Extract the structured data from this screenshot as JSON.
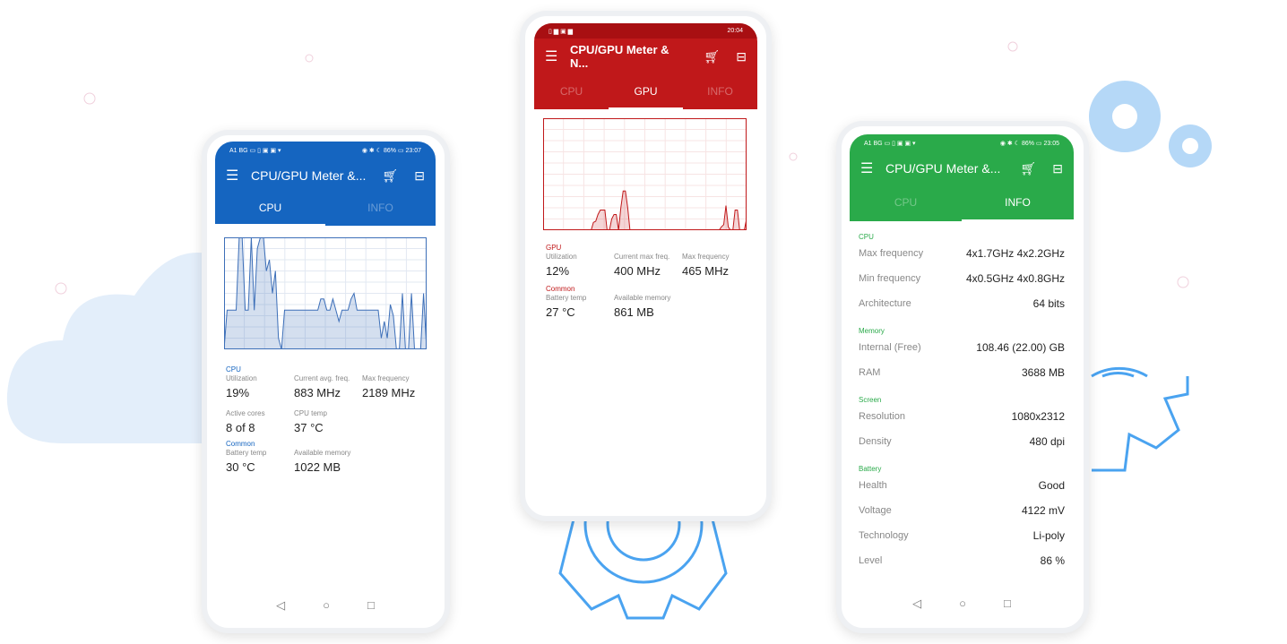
{
  "app_title": "CPU/GPU Meter & N...",
  "app_title_short": "CPU/GPU Meter &...",
  "icons": [
    "menu-icon",
    "cart-icon",
    "gift-icon",
    "back-icon",
    "home-icon",
    "recents-icon"
  ],
  "colors": {
    "blue": "#1565c0",
    "red": "#c0181a",
    "green": "#2aaa4a"
  },
  "left": {
    "status_left": "A1 BG ▭ ▯ ▣ ▣ ▾",
    "status_right": "◉ ✱ ☾ 86% ▭ 23:07",
    "tabs": [
      "CPU",
      "INFO"
    ],
    "active_tab": "CPU",
    "chart_values": [
      0,
      35,
      35,
      35,
      35,
      100,
      100,
      35,
      35,
      100,
      35,
      90,
      100,
      100,
      70,
      80,
      50,
      70,
      10,
      0,
      35,
      35,
      35,
      35,
      35,
      35,
      35,
      35,
      35,
      35,
      35,
      35,
      45,
      45,
      35,
      35,
      45,
      35,
      25,
      35,
      35,
      35,
      45,
      50,
      35,
      35,
      35,
      35,
      35,
      35,
      35,
      35,
      10,
      25,
      10,
      40,
      30,
      0,
      0,
      50,
      0,
      0,
      50,
      0,
      0,
      0,
      50,
      0
    ],
    "section_cpu": "CPU",
    "metrics": [
      {
        "label": "Utilization",
        "value": "19%"
      },
      {
        "label": "Current avg. freq.",
        "value": "883 MHz"
      },
      {
        "label": "Max frequency",
        "value": "2189 MHz"
      },
      {
        "label": "Active cores",
        "value": "8 of 8"
      },
      {
        "label": "CPU temp",
        "value": "37 °C"
      }
    ],
    "section_common": "Common",
    "common": [
      {
        "label": "Battery temp",
        "value": "30 °C"
      },
      {
        "label": "Available memory",
        "value": "1022 MB"
      }
    ]
  },
  "middle": {
    "status_right": "20:04",
    "tabs": [
      "CPU",
      "GPU",
      "INFO"
    ],
    "active_tab": "GPU",
    "chart_values": [
      0,
      0,
      0,
      0,
      0,
      0,
      0,
      0,
      0,
      0,
      0,
      0,
      0,
      0,
      0,
      0,
      0,
      0,
      0,
      0,
      0,
      0,
      7,
      8,
      14,
      18,
      18,
      18,
      0,
      0,
      10,
      14,
      14,
      0,
      20,
      35,
      35,
      20,
      0,
      0,
      0,
      0,
      0,
      0,
      0,
      0,
      0,
      0,
      0,
      0,
      0,
      0,
      0,
      0,
      0,
      0,
      0,
      0,
      0,
      0,
      0,
      0,
      0,
      0,
      0,
      0,
      0,
      0,
      0,
      0,
      0,
      0,
      0,
      0,
      0,
      0,
      0,
      0,
      3,
      5,
      22,
      3,
      0,
      0,
      18,
      18,
      0,
      0,
      0,
      10
    ],
    "section_gpu": "GPU",
    "metrics": [
      {
        "label": "Utilization",
        "value": "12%"
      },
      {
        "label": "Current max freq.",
        "value": "400 MHz"
      },
      {
        "label": "Max frequency",
        "value": "465 MHz"
      }
    ],
    "section_common": "Common",
    "common": [
      {
        "label": "Battery temp",
        "value": "27 °C"
      },
      {
        "label": "Available memory",
        "value": "861 MB"
      }
    ]
  },
  "right": {
    "status_left": "A1 BG ▭ ▯ ▣ ▣ ▾",
    "status_right": "◉ ✱ ☾ 86% ▭ 23:05",
    "tabs": [
      "CPU",
      "INFO"
    ],
    "active_tab": "INFO",
    "sections": [
      {
        "title": "CPU",
        "rows": [
          {
            "k": "Max frequency",
            "v": "4x1.7GHz 4x2.2GHz"
          },
          {
            "k": "Min frequency",
            "v": "4x0.5GHz 4x0.8GHz"
          },
          {
            "k": "Architecture",
            "v": "64 bits"
          }
        ]
      },
      {
        "title": "Memory",
        "rows": [
          {
            "k": "Internal (Free)",
            "v": "108.46 (22.00) GB"
          },
          {
            "k": "RAM",
            "v": "3688 MB"
          }
        ]
      },
      {
        "title": "Screen",
        "rows": [
          {
            "k": "Resolution",
            "v": "1080x2312"
          },
          {
            "k": "Density",
            "v": "480 dpi"
          }
        ]
      },
      {
        "title": "Battery",
        "rows": [
          {
            "k": "Health",
            "v": "Good"
          },
          {
            "k": "Voltage",
            "v": "4122 mV"
          },
          {
            "k": "Technology",
            "v": "Li-poly"
          },
          {
            "k": "Level",
            "v": "86 %"
          }
        ]
      }
    ]
  },
  "nav": {
    "back": "◁",
    "home": "○",
    "recents": "□"
  }
}
